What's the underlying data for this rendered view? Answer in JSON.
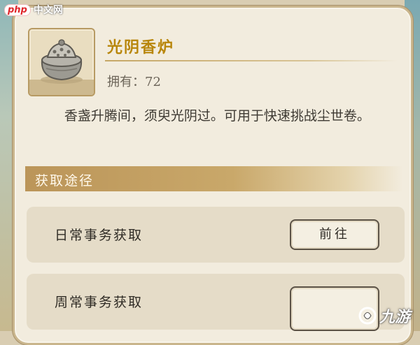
{
  "watermark": {
    "php_badge": "php",
    "php_site": "中文网",
    "site_9you": "九游"
  },
  "item": {
    "name": "光阴香炉",
    "owned_label": "拥有：",
    "owned_count": "72",
    "description": "香盏升腾间，须臾光阴过。可用于快速挑战尘世卷。",
    "icon": "incense-burner-icon"
  },
  "acquire": {
    "title": "获取途径",
    "rows": [
      {
        "label": "日常事务获取",
        "button": "前往"
      },
      {
        "label": "周常事务获取",
        "button": ""
      }
    ]
  },
  "colors": {
    "title_gold": "#b8860b",
    "section_bar": "#bb9559",
    "panel_bg": "#f2ecde"
  }
}
